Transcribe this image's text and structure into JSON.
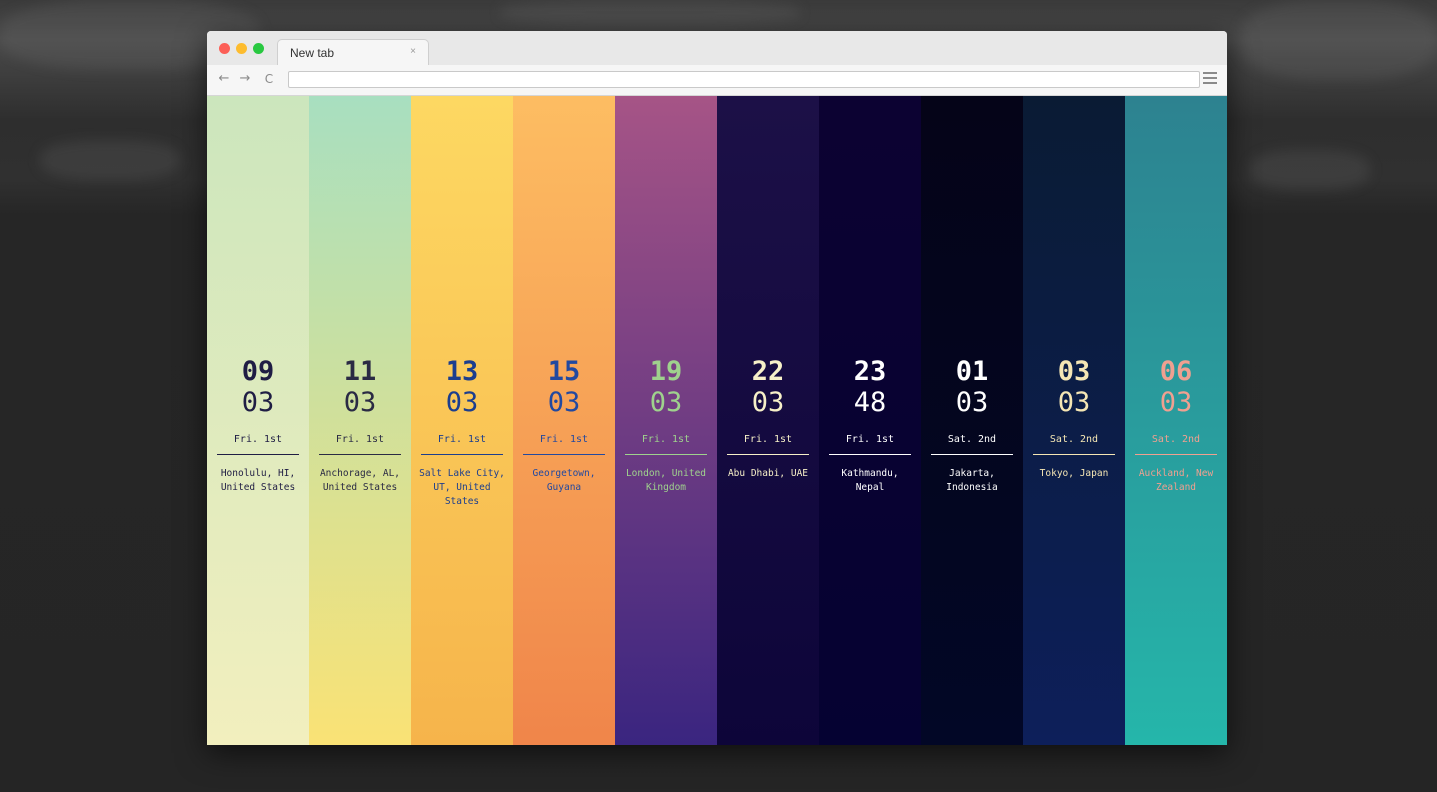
{
  "browser": {
    "tab_title": "New tab",
    "tab_close": "×",
    "back": "←",
    "forward": "→",
    "reload": "C",
    "address_value": "",
    "traffic_colors": [
      "#fc5f57",
      "#fdbc2e",
      "#28c840"
    ]
  },
  "clocks": [
    {
      "hour": "09",
      "minute": "03",
      "date": "Fri. 1st",
      "city": "Honolulu, HI, United States",
      "bg_top": "#cce6bd",
      "bg_bottom": "#f2efbe",
      "text_color": "#1f1d44",
      "accent": "#1f1d44"
    },
    {
      "hour": "11",
      "minute": "03",
      "date": "Fri. 1st",
      "city": "Anchorage, AL, United States",
      "bg_top": "#a8dfc0",
      "bg_bottom": "#fae275",
      "text_color": "#2a2a44",
      "accent": "#2a2a44"
    },
    {
      "hour": "13",
      "minute": "03",
      "date": "Fri. 1st",
      "city": "Salt Lake City, UT, United States",
      "bg_top": "#fdd862",
      "bg_bottom": "#f6b44b",
      "text_color": "#1c3e8e",
      "accent": "#1c3e8e"
    },
    {
      "hour": "15",
      "minute": "03",
      "date": "Fri. 1st",
      "city": "Georgetown, Guyana",
      "bg_top": "#fdbd62",
      "bg_bottom": "#f0854a",
      "text_color": "#2249a0",
      "accent": "#2249a0"
    },
    {
      "hour": "19",
      "minute": "03",
      "date": "Fri. 1st",
      "city": "London, United Kingdom",
      "bg_top": "#a65486",
      "bg_bottom": "#3a2580",
      "text_color": "#9fd28d",
      "accent": "#9fd28d"
    },
    {
      "hour": "22",
      "minute": "03",
      "date": "Fri. 1st",
      "city": "Abu Dhabi, UAE",
      "bg_top": "#1c1047",
      "bg_bottom": "#0d0539",
      "text_color": "#f7f0c8",
      "accent": "#f7f0c8"
    },
    {
      "hour": "23",
      "minute": "48",
      "date": "Fri. 1st",
      "city": "Kathmandu, Nepal",
      "bg_top": "#0c0232",
      "bg_bottom": "#050232",
      "text_color": "#ffffff",
      "accent": "#ffffff"
    },
    {
      "hour": "01",
      "minute": "03",
      "date": "Sat. 2nd",
      "city": "Jakarta, Indonesia",
      "bg_top": "#050418",
      "bg_bottom": "#020726",
      "text_color": "#ffffff",
      "accent": "#ffffff"
    },
    {
      "hour": "03",
      "minute": "03",
      "date": "Sat. 2nd",
      "city": "Tokyo, Japan",
      "bg_top": "#0a1b34",
      "bg_bottom": "#0d1f5a",
      "text_color": "#f5e6b4",
      "accent": "#f5e6b4"
    },
    {
      "hour": "06",
      "minute": "03",
      "date": "Sat. 2nd",
      "city": "Auckland, New Zealand",
      "bg_top": "#2d8290",
      "bg_bottom": "#25b6aa",
      "text_color": "#f0a090",
      "accent": "#f0a090"
    }
  ]
}
